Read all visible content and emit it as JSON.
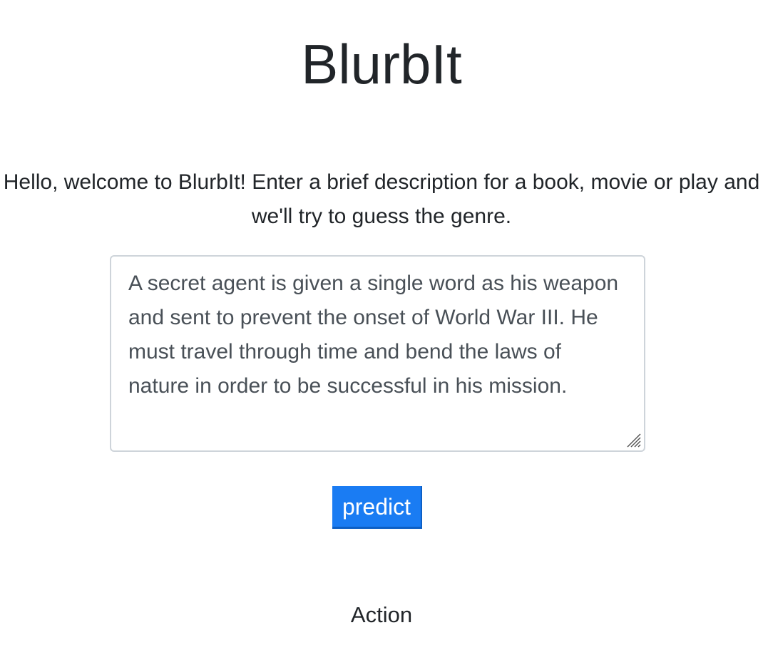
{
  "app": {
    "title": "BlurbIt"
  },
  "intro": {
    "text": "Hello, welcome to BlurbIt! Enter a brief description for a book, movie or play and we'll try to guess the genre."
  },
  "blurb_input": {
    "value": "A secret agent is given a single word as his weapon and sent to prevent the onset of World War III. He must travel through time and bend the laws of nature in order to be successful in his mission."
  },
  "predict_button": {
    "label": "predict"
  },
  "result": {
    "genre": "Action"
  },
  "colors": {
    "button_bg": "#1a7cf3",
    "text": "#212529",
    "input_text": "#495057",
    "input_border": "#ced4da"
  }
}
